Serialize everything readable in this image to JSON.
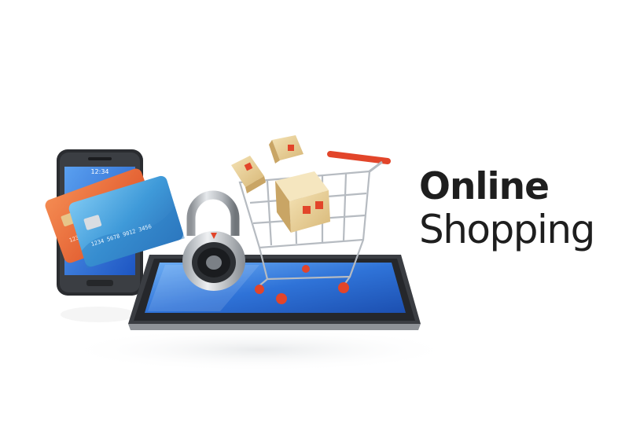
{
  "headline": {
    "line1": "Online",
    "line2": "Shopping"
  },
  "phone": {
    "status_time": "12:34"
  },
  "cards": {
    "front_text": "1234 5678 9012 3456",
    "back_text": "1234 5678"
  },
  "colors": {
    "background": "#ffffff",
    "text": "#1e1e1e",
    "screen_blue": "#2f73d8",
    "cart_handle": "#e2452a",
    "card_orange": "#e8622f",
    "card_blue": "#4aa6e0",
    "box_tan": "#e9cf95"
  },
  "icons": [
    "smartphone-icon",
    "credit-card-icon",
    "padlock-icon",
    "shopping-cart-icon",
    "package-icon",
    "tablet-icon"
  ]
}
